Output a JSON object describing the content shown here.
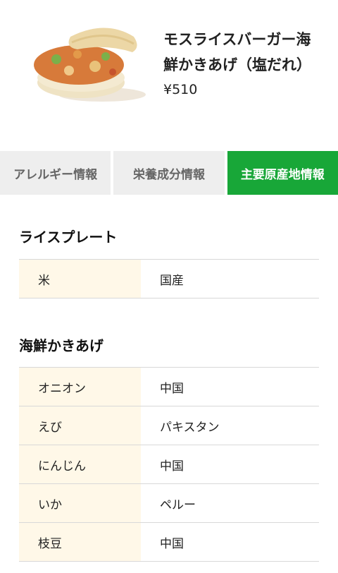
{
  "product": {
    "title": "モスライスバーガー海鮮かきあげ（塩だれ）",
    "price": "¥510"
  },
  "tabs": [
    {
      "label": "アレルギー情報",
      "active": false
    },
    {
      "label": "栄養成分情報",
      "active": false
    },
    {
      "label": "主要原産地情報",
      "active": true
    }
  ],
  "sections": [
    {
      "title": "ライスプレート",
      "rows": [
        {
          "item": "米",
          "origin": "国産"
        }
      ]
    },
    {
      "title": "海鮮かきあげ",
      "rows": [
        {
          "item": "オニオン",
          "origin": "中国"
        },
        {
          "item": "えび",
          "origin": "パキスタン"
        },
        {
          "item": "にんじん",
          "origin": "中国"
        },
        {
          "item": "いか",
          "origin": "ペルー"
        },
        {
          "item": "枝豆",
          "origin": "中国"
        }
      ]
    }
  ],
  "colors": {
    "accent": "#18a738",
    "label_bg": "#fff8e8",
    "tab_bg": "#eeeeee"
  }
}
